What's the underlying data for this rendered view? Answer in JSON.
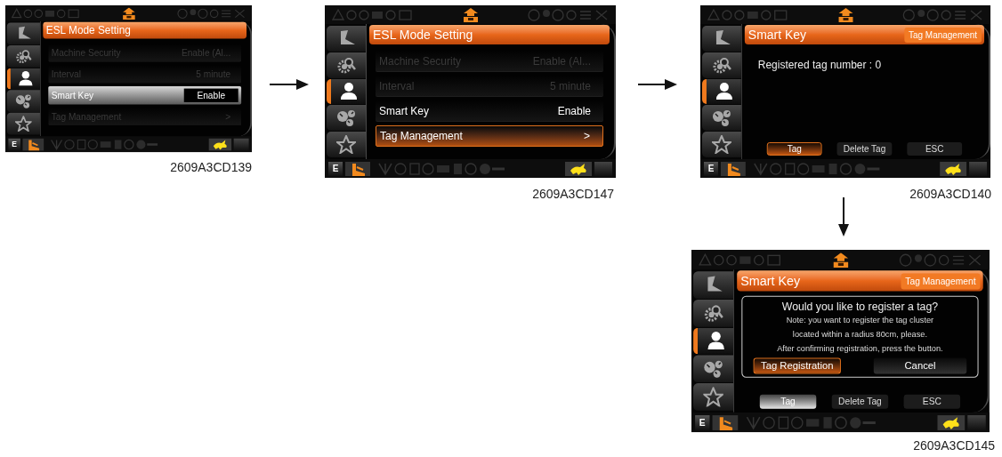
{
  "screens": [
    {
      "caption": "2609A3CD139",
      "mode_label": "E",
      "tabs": [
        {
          "kind": "bucket",
          "selected": false
        },
        {
          "kind": "inspect",
          "selected": false
        },
        {
          "kind": "user",
          "selected": true
        },
        {
          "kind": "gauges",
          "selected": false
        },
        {
          "kind": "favorites",
          "selected": false
        }
      ],
      "header": {
        "title": "ESL Mode Setting"
      },
      "content": {
        "kind": "menu",
        "rows": [
          {
            "label": "Machine Security",
            "value": "Enable (Al...",
            "disabled": true,
            "selected": false,
            "editing": false
          },
          {
            "label": "Interval",
            "value": "5 minute",
            "disabled": true,
            "selected": false,
            "editing": false
          },
          {
            "label": "Smart Key",
            "value": "Enable",
            "disabled": false,
            "selected": true,
            "editing": true
          },
          {
            "label": "Tag Management",
            "value": ">",
            "disabled": true,
            "selected": false,
            "editing": false
          }
        ]
      }
    },
    {
      "caption": "2609A3CD147",
      "mode_label": "E",
      "tabs": [
        {
          "kind": "bucket",
          "selected": false
        },
        {
          "kind": "inspect",
          "selected": false
        },
        {
          "kind": "user",
          "selected": true
        },
        {
          "kind": "gauges",
          "selected": false
        },
        {
          "kind": "favorites",
          "selected": false
        }
      ],
      "header": {
        "title": "ESL Mode Setting"
      },
      "content": {
        "kind": "menu",
        "rows": [
          {
            "label": "Machine Security",
            "value": "Enable (Al...",
            "disabled": true,
            "selected": false,
            "editing": false
          },
          {
            "label": "Interval",
            "value": "5 minute",
            "disabled": true,
            "selected": false,
            "editing": false
          },
          {
            "label": "Smart Key",
            "value": "Enable",
            "disabled": false,
            "selected": false,
            "editing": false
          },
          {
            "label": "Tag Management",
            "value": ">",
            "disabled": false,
            "selected": true,
            "editing": false
          }
        ]
      }
    },
    {
      "caption": "2609A3CD140",
      "mode_label": "E",
      "tabs": [
        {
          "kind": "bucket",
          "selected": false
        },
        {
          "kind": "inspect",
          "selected": false
        },
        {
          "kind": "user",
          "selected": true
        },
        {
          "kind": "gauges",
          "selected": false
        },
        {
          "kind": "favorites",
          "selected": false
        }
      ],
      "header": {
        "title": "Smart Key",
        "badge": "Tag Management"
      },
      "content": {
        "kind": "info",
        "text": "Registered tag number : 0",
        "buttons": [
          {
            "label": "Tag",
            "selected": true
          },
          {
            "label": "Delete Tag",
            "selected": false
          },
          {
            "label": "ESC",
            "selected": false
          }
        ]
      }
    },
    {
      "caption": "2609A3CD145",
      "mode_label": "E",
      "tabs": [
        {
          "kind": "bucket",
          "selected": false
        },
        {
          "kind": "inspect",
          "selected": false
        },
        {
          "kind": "user",
          "selected": true
        },
        {
          "kind": "gauges",
          "selected": false
        },
        {
          "kind": "favorites",
          "selected": false
        }
      ],
      "header": {
        "title": "Smart Key",
        "badge": "Tag Management"
      },
      "content": {
        "kind": "dialog",
        "dialog": {
          "title": "Would you like to register a tag?",
          "lines": [
            "Note: you want to register the tag cluster",
            "located within a radius 80cm, please.",
            "After confirming registration, press the button."
          ],
          "buttons": [
            {
              "label": "Tag Registration",
              "selected": true
            },
            {
              "label": "Cancel",
              "selected": false
            }
          ]
        },
        "buttons": [
          {
            "label": "Tag",
            "selected": true
          },
          {
            "label": "Delete Tag",
            "selected": false
          },
          {
            "label": "ESC",
            "selected": false
          }
        ]
      }
    }
  ]
}
